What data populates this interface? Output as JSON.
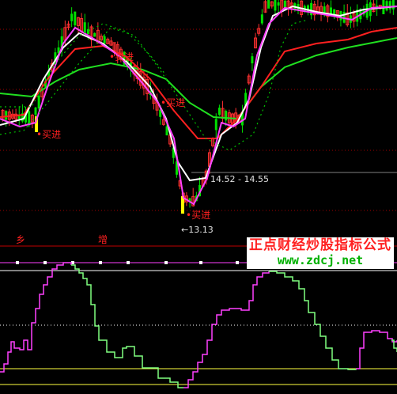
{
  "chart_data": [
    {
      "type": "candlestick",
      "panel": "price",
      "title": "",
      "xlabel": "",
      "ylabel": "",
      "colors": {
        "up": "#ff3030",
        "down": "#00e000",
        "ma_fast": "#ff40ff",
        "ma_mid": "#ffffff",
        "ma_slow": "#ff2020",
        "ma_long": "#20e020",
        "dots": "#00c000",
        "buy": "#ff2020"
      },
      "annotations": {
        "buy_labels": [
          "买进",
          "买进",
          "买进",
          "买进"
        ],
        "range_label": "14.52 - 14.55",
        "low_label": "13.13",
        "left_mark": "乡",
        "mid_mark": "增"
      }
    },
    {
      "type": "line",
      "panel": "oscillator",
      "title": "",
      "series": [],
      "colors": {
        "line_up": "#ff40ff",
        "line_down": "#80ff80",
        "hline_top": "#ffffff",
        "hline_bottom": "#ffff40",
        "mid_dotted": "#ffffff",
        "top_band": "#ff40ff"
      }
    }
  ],
  "watermark": {
    "line1": "正点财经炒股指标公式",
    "line2": "www.zdcj.net",
    "color1": "#ff2020",
    "color2": "#00d000",
    "bg": "#ffffff"
  }
}
